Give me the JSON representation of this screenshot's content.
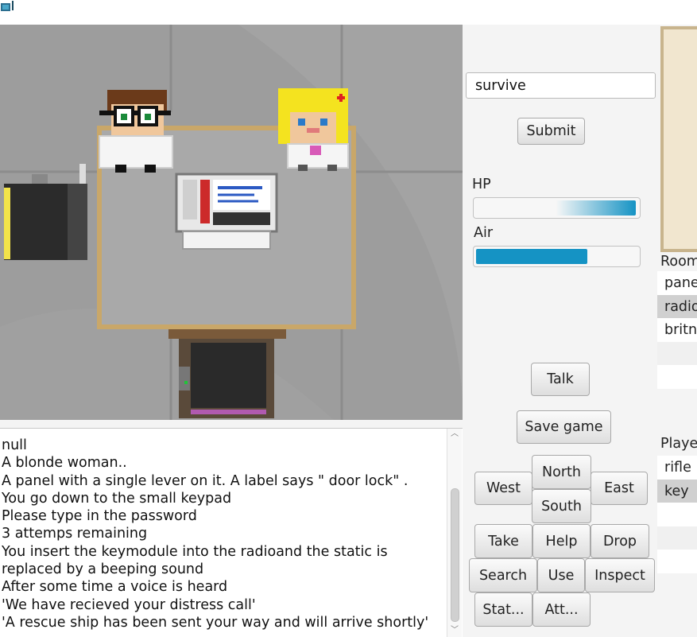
{
  "command": {
    "value": "survive"
  },
  "buttons": {
    "submit": "Submit",
    "talk": "Talk",
    "save": "Save game",
    "north": "North",
    "west": "West",
    "east": "East",
    "south": "South",
    "take": "Take",
    "help": "Help",
    "drop": "Drop",
    "search": "Search",
    "use": "Use",
    "inspect": "Inspect",
    "stat": "Stat...",
    "att": "Att..."
  },
  "stats": {
    "hp_label": "HP",
    "hp_level": 0.99,
    "air_label": "Air",
    "air_level": 0.69,
    "hp_color": "#1593c4",
    "air_color": "#1593c4"
  },
  "log": {
    "lines": [
      "null",
      "A blonde woman..",
      "A panel with a single lever on it. A label says \" door lock\" .",
      "You go down to the small keypad",
      "Please type in the password",
      "3 attemps remaining",
      "You insert the keymodule into the radioand the static is replaced by a beeping sound",
      "After some time a voice is heard",
      "'We have recieved your distress call'",
      "'A rescue ship has been sent your way and will arrive shortly'"
    ]
  },
  "room": {
    "title": "Room",
    "items": [
      {
        "label": "pane",
        "selected": false
      },
      {
        "label": "radio",
        "selected": true
      },
      {
        "label": "britne",
        "selected": false
      }
    ]
  },
  "player": {
    "title": "Player",
    "items": [
      {
        "label": "rifle",
        "selected": false
      },
      {
        "label": "key",
        "selected": true
      }
    ]
  },
  "colors": {
    "scene_floor": "#9d9d9d",
    "table": "#a9a9a9",
    "table_border": "#c9a769",
    "list_selected": "#d0d0d0",
    "list_alt": "#f0f0f0"
  }
}
